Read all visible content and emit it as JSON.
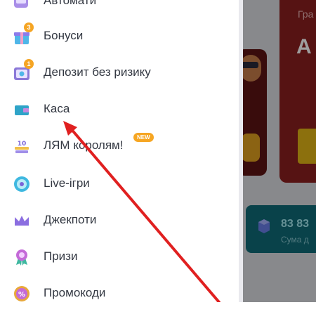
{
  "menu": {
    "items": [
      {
        "label": "Автомати",
        "icon": "slot-machine-icon"
      },
      {
        "label": "Бонуси",
        "icon": "gift-icon",
        "badge": "3"
      },
      {
        "label": "Депозит без ризику",
        "icon": "safe-icon",
        "badge": "1"
      },
      {
        "label": "Каса",
        "icon": "wallet-icon"
      },
      {
        "label": "ЛЯМ королям!",
        "icon": "million-icon",
        "tag": "NEW"
      },
      {
        "label": "Live-ігри",
        "icon": "live-chip-icon"
      },
      {
        "label": "Джекпоти",
        "icon": "crown-icon"
      },
      {
        "label": "Призи",
        "icon": "medal-icon"
      },
      {
        "label": "Промокоди",
        "icon": "promo-code-icon"
      }
    ]
  },
  "promo": {
    "small_text": "Гра",
    "big_text": "А"
  },
  "jackpot": {
    "amount": "83 83",
    "subtitle": "Сума д"
  },
  "colors": {
    "accent": "#f5a524",
    "annotation_arrow": "#e02020",
    "sidebar_bg": "#ffffff"
  }
}
